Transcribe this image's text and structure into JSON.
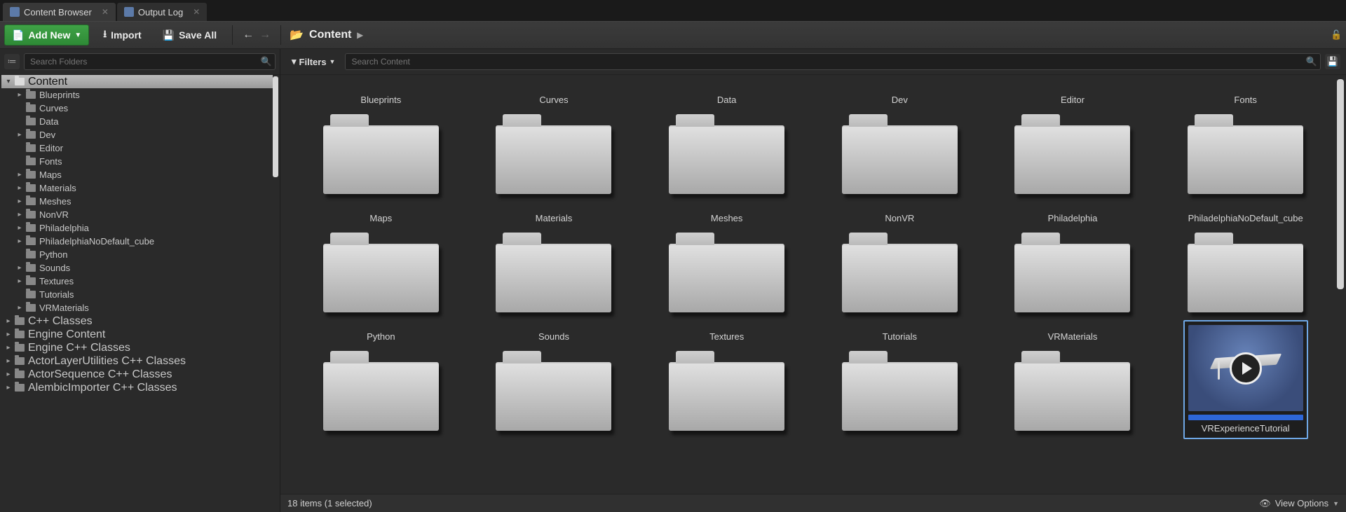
{
  "tabs": [
    {
      "label": "Content Browser",
      "active": true
    },
    {
      "label": "Output Log",
      "active": false
    }
  ],
  "toolbar": {
    "add_new": "Add New",
    "import": "Import",
    "save_all": "Save All"
  },
  "breadcrumb": {
    "root": "Content"
  },
  "sidebar": {
    "search_placeholder": "Search Folders",
    "tree": [
      {
        "label": "Content",
        "depth": 0,
        "expandable": true,
        "expanded": true,
        "selected": true
      },
      {
        "label": "Blueprints",
        "depth": 1,
        "expandable": true
      },
      {
        "label": "Curves",
        "depth": 1,
        "expandable": false
      },
      {
        "label": "Data",
        "depth": 1,
        "expandable": false
      },
      {
        "label": "Dev",
        "depth": 1,
        "expandable": true
      },
      {
        "label": "Editor",
        "depth": 1,
        "expandable": false
      },
      {
        "label": "Fonts",
        "depth": 1,
        "expandable": false
      },
      {
        "label": "Maps",
        "depth": 1,
        "expandable": true
      },
      {
        "label": "Materials",
        "depth": 1,
        "expandable": true
      },
      {
        "label": "Meshes",
        "depth": 1,
        "expandable": true
      },
      {
        "label": "NonVR",
        "depth": 1,
        "expandable": true
      },
      {
        "label": "Philadelphia",
        "depth": 1,
        "expandable": true
      },
      {
        "label": "PhiladelphiaNoDefault_cube",
        "depth": 1,
        "expandable": true
      },
      {
        "label": "Python",
        "depth": 1,
        "expandable": false
      },
      {
        "label": "Sounds",
        "depth": 1,
        "expandable": true
      },
      {
        "label": "Textures",
        "depth": 1,
        "expandable": true
      },
      {
        "label": "Tutorials",
        "depth": 1,
        "expandable": false
      },
      {
        "label": "VRMaterials",
        "depth": 1,
        "expandable": true
      },
      {
        "label": "C++ Classes",
        "depth": 0,
        "expandable": true
      },
      {
        "label": "Engine Content",
        "depth": 0,
        "expandable": true
      },
      {
        "label": "Engine C++ Classes",
        "depth": 0,
        "expandable": true
      },
      {
        "label": "ActorLayerUtilities C++ Classes",
        "depth": 0,
        "expandable": true
      },
      {
        "label": "ActorSequence C++ Classes",
        "depth": 0,
        "expandable": true
      },
      {
        "label": "AlembicImporter C++ Classes",
        "depth": 0,
        "expandable": true
      }
    ]
  },
  "content": {
    "filters_label": "Filters",
    "search_placeholder": "Search Content",
    "items": [
      {
        "type": "folder",
        "label": "Blueprints"
      },
      {
        "type": "folder",
        "label": "Curves"
      },
      {
        "type": "folder",
        "label": "Data"
      },
      {
        "type": "folder",
        "label": "Dev"
      },
      {
        "type": "folder",
        "label": "Editor"
      },
      {
        "type": "folder",
        "label": "Fonts"
      },
      {
        "type": "folder",
        "label": "Maps"
      },
      {
        "type": "folder",
        "label": "Materials"
      },
      {
        "type": "folder",
        "label": "Meshes"
      },
      {
        "type": "folder",
        "label": "NonVR"
      },
      {
        "type": "folder",
        "label": "Philadelphia"
      },
      {
        "type": "folder",
        "label": "PhiladelphiaNoDefault_cube"
      },
      {
        "type": "folder",
        "label": "Python"
      },
      {
        "type": "folder",
        "label": "Sounds"
      },
      {
        "type": "folder",
        "label": "Textures"
      },
      {
        "type": "folder",
        "label": "Tutorials"
      },
      {
        "type": "folder",
        "label": "VRMaterials"
      },
      {
        "type": "tutorial-asset",
        "label": "VRExperienceTutorial",
        "selected": true
      }
    ]
  },
  "status": {
    "text": "18 items (1 selected)",
    "view_options": "View Options"
  }
}
